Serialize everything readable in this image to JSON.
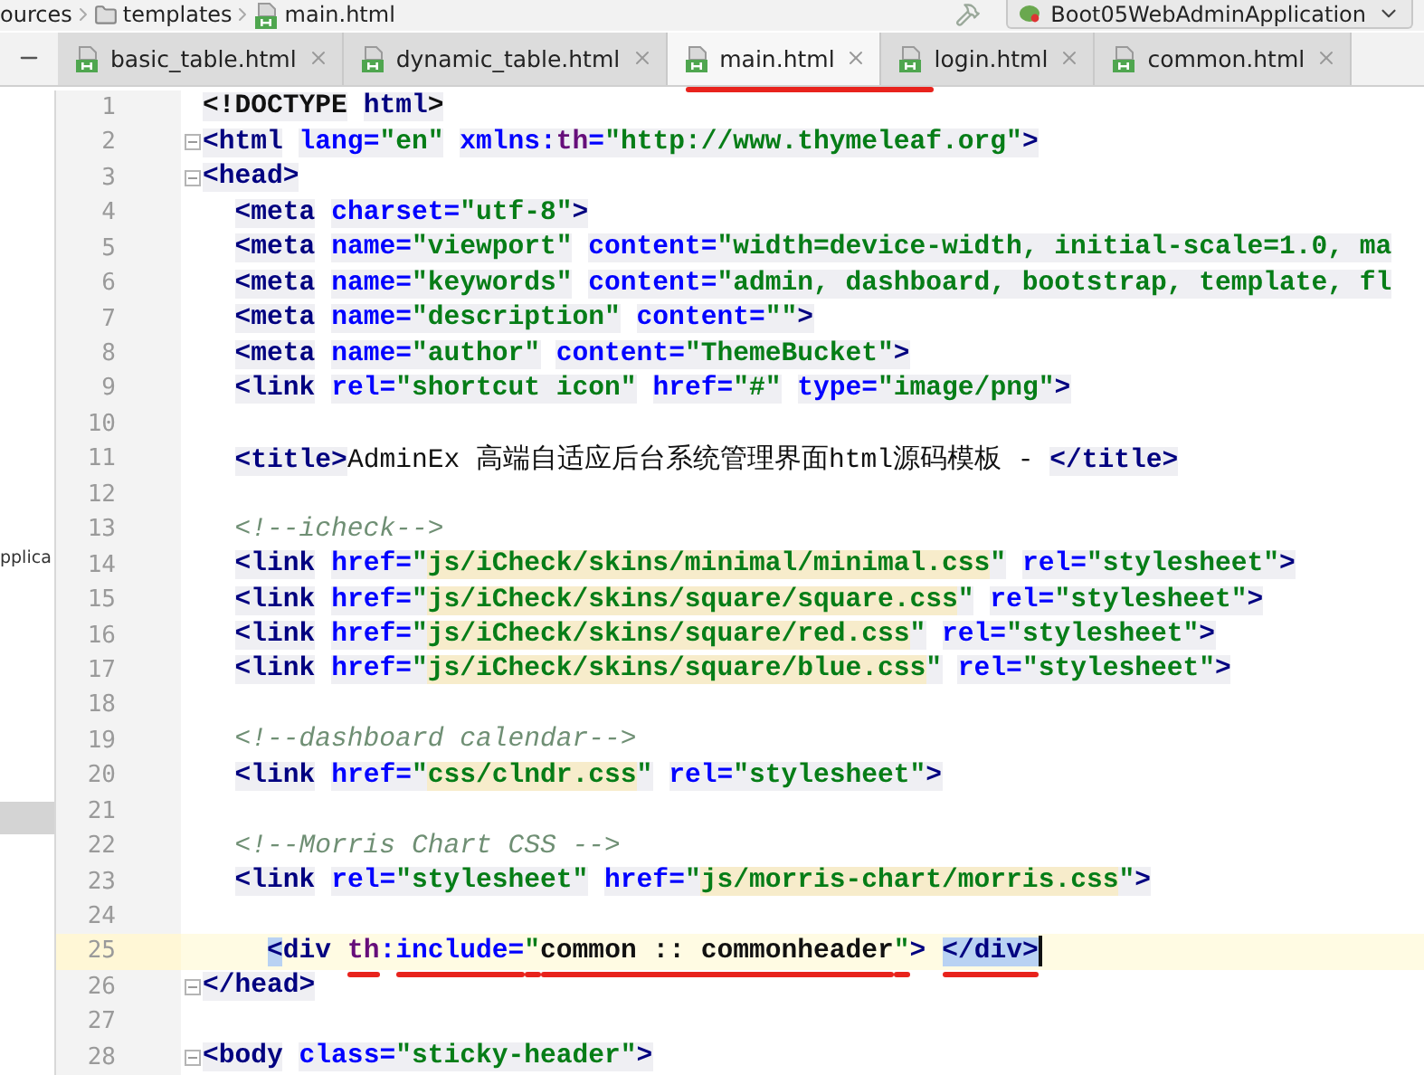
{
  "breadcrumb": [
    {
      "label": "ources",
      "kind": "plain"
    },
    {
      "label": "templates",
      "kind": "folder"
    },
    {
      "label": "main.html",
      "kind": "html"
    }
  ],
  "run_config": {
    "label": "Boot05WebAdminApplication"
  },
  "tabs": [
    {
      "label": "basic_table.html",
      "selected": false,
      "underlined": false
    },
    {
      "label": "dynamic_table.html",
      "selected": false,
      "underlined": false
    },
    {
      "label": "main.html",
      "selected": true,
      "underlined": true
    },
    {
      "label": "login.html",
      "selected": false,
      "underlined": false
    },
    {
      "label": "common.html",
      "selected": false,
      "underlined": false
    }
  ],
  "project_panel": {
    "label": "pplica"
  },
  "code_lines": [
    {
      "n": "1",
      "fold": false,
      "current": false,
      "tokens": [
        {
          "kind": "punct",
          "text": "<!DOCTYPE"
        },
        {
          "kind": "tag",
          "text": " html"
        },
        {
          "kind": "punct",
          "text": ">"
        }
      ]
    },
    {
      "n": "2",
      "fold": true,
      "current": false,
      "tokens": [
        {
          "kind": "tag",
          "text": "<html"
        },
        {
          "kind": "attr",
          "text": " lang="
        },
        {
          "kind": "str",
          "text": "\"en\""
        },
        {
          "kind": "attr",
          "text": " xmlns:"
        },
        {
          "kind": "ns",
          "text": "th"
        },
        {
          "kind": "attr",
          "text": "="
        },
        {
          "kind": "str",
          "text": "\"http://www.thymeleaf.org\""
        },
        {
          "kind": "tag",
          "text": ">"
        }
      ]
    },
    {
      "n": "3",
      "fold": true,
      "current": false,
      "tokens": [
        {
          "kind": "tag",
          "text": "<head>"
        }
      ]
    },
    {
      "n": "4",
      "fold": false,
      "current": false,
      "tokens": [
        {
          "kind": "tag",
          "text": "  <meta"
        },
        {
          "kind": "attr",
          "text": " charset="
        },
        {
          "kind": "str",
          "text": "\"utf-8\""
        },
        {
          "kind": "tag",
          "text": ">"
        }
      ]
    },
    {
      "n": "5",
      "fold": false,
      "current": false,
      "tokens": [
        {
          "kind": "tag",
          "text": "  <meta"
        },
        {
          "kind": "attr",
          "text": " name="
        },
        {
          "kind": "str",
          "text": "\"viewport\""
        },
        {
          "kind": "attr",
          "text": " content="
        },
        {
          "kind": "str",
          "text": "\"width=device-width, initial-scale=1.0, ma"
        }
      ]
    },
    {
      "n": "6",
      "fold": false,
      "current": false,
      "tokens": [
        {
          "kind": "tag",
          "text": "  <meta"
        },
        {
          "kind": "attr",
          "text": " name="
        },
        {
          "kind": "str",
          "text": "\"keywords\""
        },
        {
          "kind": "attr",
          "text": " content="
        },
        {
          "kind": "str",
          "text": "\"admin, dashboard, bootstrap, template, fl"
        }
      ]
    },
    {
      "n": "7",
      "fold": false,
      "current": false,
      "tokens": [
        {
          "kind": "tag",
          "text": "  <meta"
        },
        {
          "kind": "attr",
          "text": " name="
        },
        {
          "kind": "str",
          "text": "\"description\""
        },
        {
          "kind": "attr",
          "text": " content="
        },
        {
          "kind": "str",
          "text": "\"\""
        },
        {
          "kind": "tag",
          "text": ">"
        }
      ]
    },
    {
      "n": "8",
      "fold": false,
      "current": false,
      "tokens": [
        {
          "kind": "tag",
          "text": "  <meta"
        },
        {
          "kind": "attr",
          "text": " name="
        },
        {
          "kind": "str",
          "text": "\"author\""
        },
        {
          "kind": "attr",
          "text": " content="
        },
        {
          "kind": "str",
          "text": "\"ThemeBucket\""
        },
        {
          "kind": "tag",
          "text": ">"
        }
      ]
    },
    {
      "n": "9",
      "fold": false,
      "current": false,
      "tokens": [
        {
          "kind": "tag",
          "text": "  <link"
        },
        {
          "kind": "attr",
          "text": " rel="
        },
        {
          "kind": "str",
          "text": "\"shortcut icon\""
        },
        {
          "kind": "attr",
          "text": " href="
        },
        {
          "kind": "str",
          "text": "\"#\""
        },
        {
          "kind": "attr",
          "text": " type="
        },
        {
          "kind": "str",
          "text": "\"image/png\""
        },
        {
          "kind": "tag",
          "text": ">"
        }
      ]
    },
    {
      "n": "10",
      "fold": false,
      "current": false
    },
    {
      "n": "11",
      "fold": false,
      "current": false,
      "tokens": [
        {
          "kind": "tag",
          "text": "  <title>"
        },
        {
          "kind": "text",
          "text": "AdminEx 高端自适应后台系统管理界面html源码模板 - "
        },
        {
          "kind": "tag",
          "text": "</title>"
        }
      ]
    },
    {
      "n": "12",
      "fold": false,
      "current": false
    },
    {
      "n": "13",
      "fold": false,
      "current": false,
      "tokens": [
        {
          "kind": "comment",
          "text": "  <!--icheck-->"
        }
      ]
    },
    {
      "n": "14",
      "fold": false,
      "current": false,
      "tokens": [
        {
          "kind": "tag",
          "text": "  <link"
        },
        {
          "kind": "attr",
          "text": " href="
        },
        {
          "kind": "str",
          "text": "\""
        },
        {
          "kind": "path",
          "text": "js/iCheck/skins/minimal/minimal.css"
        },
        {
          "kind": "str",
          "text": "\""
        },
        {
          "kind": "attr",
          "text": " rel="
        },
        {
          "kind": "str",
          "text": "\"stylesheet\""
        },
        {
          "kind": "tag",
          "text": ">"
        }
      ]
    },
    {
      "n": "15",
      "fold": false,
      "current": false,
      "tokens": [
        {
          "kind": "tag",
          "text": "  <link"
        },
        {
          "kind": "attr",
          "text": " href="
        },
        {
          "kind": "str",
          "text": "\""
        },
        {
          "kind": "path",
          "text": "js/iCheck/skins/square/square.css"
        },
        {
          "kind": "str",
          "text": "\""
        },
        {
          "kind": "attr",
          "text": " rel="
        },
        {
          "kind": "str",
          "text": "\"stylesheet\""
        },
        {
          "kind": "tag",
          "text": ">"
        }
      ]
    },
    {
      "n": "16",
      "fold": false,
      "current": false,
      "tokens": [
        {
          "kind": "tag",
          "text": "  <link"
        },
        {
          "kind": "attr",
          "text": " href="
        },
        {
          "kind": "str",
          "text": "\""
        },
        {
          "kind": "path",
          "text": "js/iCheck/skins/square/red.css"
        },
        {
          "kind": "str",
          "text": "\""
        },
        {
          "kind": "attr",
          "text": " rel="
        },
        {
          "kind": "str",
          "text": "\"stylesheet\""
        },
        {
          "kind": "tag",
          "text": ">"
        }
      ]
    },
    {
      "n": "17",
      "fold": false,
      "current": false,
      "tokens": [
        {
          "kind": "tag",
          "text": "  <link"
        },
        {
          "kind": "attr",
          "text": " href="
        },
        {
          "kind": "str",
          "text": "\""
        },
        {
          "kind": "path",
          "text": "js/iCheck/skins/square/blue.css"
        },
        {
          "kind": "str",
          "text": "\""
        },
        {
          "kind": "attr",
          "text": " rel="
        },
        {
          "kind": "str",
          "text": "\"stylesheet\""
        },
        {
          "kind": "tag",
          "text": ">"
        }
      ]
    },
    {
      "n": "18",
      "fold": false,
      "current": false
    },
    {
      "n": "19",
      "fold": false,
      "current": false,
      "tokens": [
        {
          "kind": "comment",
          "text": "  <!--dashboard calendar-->"
        }
      ]
    },
    {
      "n": "20",
      "fold": false,
      "current": false,
      "tokens": [
        {
          "kind": "tag",
          "text": "  <link"
        },
        {
          "kind": "attr",
          "text": " href="
        },
        {
          "kind": "str",
          "text": "\""
        },
        {
          "kind": "path",
          "text": "css/clndr.css"
        },
        {
          "kind": "str",
          "text": "\""
        },
        {
          "kind": "attr",
          "text": " rel="
        },
        {
          "kind": "str",
          "text": "\"stylesheet\""
        },
        {
          "kind": "tag",
          "text": ">"
        }
      ]
    },
    {
      "n": "21",
      "fold": false,
      "current": false
    },
    {
      "n": "22",
      "fold": false,
      "current": false,
      "tokens": [
        {
          "kind": "comment",
          "text": "  <!--Morris Chart CSS -->"
        }
      ]
    },
    {
      "n": "23",
      "fold": false,
      "current": false,
      "tokens": [
        {
          "kind": "tag",
          "text": "  <link"
        },
        {
          "kind": "attr",
          "text": " rel="
        },
        {
          "kind": "str",
          "text": "\"stylesheet\""
        },
        {
          "kind": "attr",
          "text": " href="
        },
        {
          "kind": "str",
          "text": "\""
        },
        {
          "kind": "path",
          "text": "js/morris-chart/morris.css"
        },
        {
          "kind": "str",
          "text": "\""
        },
        {
          "kind": "tag",
          "text": ">"
        }
      ]
    },
    {
      "n": "24",
      "fold": false,
      "current": false
    },
    {
      "n": "25",
      "fold": false,
      "current": true,
      "tokens": [
        {
          "kind": "tag",
          "text": "    <",
          "highlighted": true,
          "underlined": false
        },
        {
          "kind": "tag",
          "text": "div",
          "highlighted": false,
          "underlined": false
        },
        {
          "kind": "ns",
          "text": " th",
          "highlighted": false,
          "underlined": true
        },
        {
          "kind": "attr",
          "text": ":",
          "highlighted": false,
          "underlined": false
        },
        {
          "kind": "attr",
          "text": "include=",
          "highlighted": false,
          "underlined": true
        },
        {
          "kind": "str",
          "text": "\"",
          "highlighted": false,
          "underlined": true
        },
        {
          "kind": "text",
          "text": "common :: commonheader",
          "highlighted": false,
          "underlined": true
        },
        {
          "kind": "str",
          "text": "\"",
          "highlighted": false,
          "underlined": true
        },
        {
          "kind": "tag",
          "text": ">",
          "highlighted": false,
          "underlined": false
        },
        {
          "kind": "tag",
          "text": " </div>",
          "highlighted": true,
          "underlined": true
        }
      ]
    },
    {
      "n": "26",
      "fold": true,
      "current": false,
      "tokens": [
        {
          "kind": "tag",
          "text": "</head>"
        }
      ]
    },
    {
      "n": "27",
      "fold": false,
      "current": false
    },
    {
      "n": "28",
      "fold": true,
      "current": false,
      "tokens": [
        {
          "kind": "tag",
          "text": "<body"
        },
        {
          "kind": "attr",
          "text": " class="
        },
        {
          "kind": "str",
          "text": "\"sticky-header\""
        },
        {
          "kind": "tag",
          "text": ">"
        }
      ]
    }
  ]
}
